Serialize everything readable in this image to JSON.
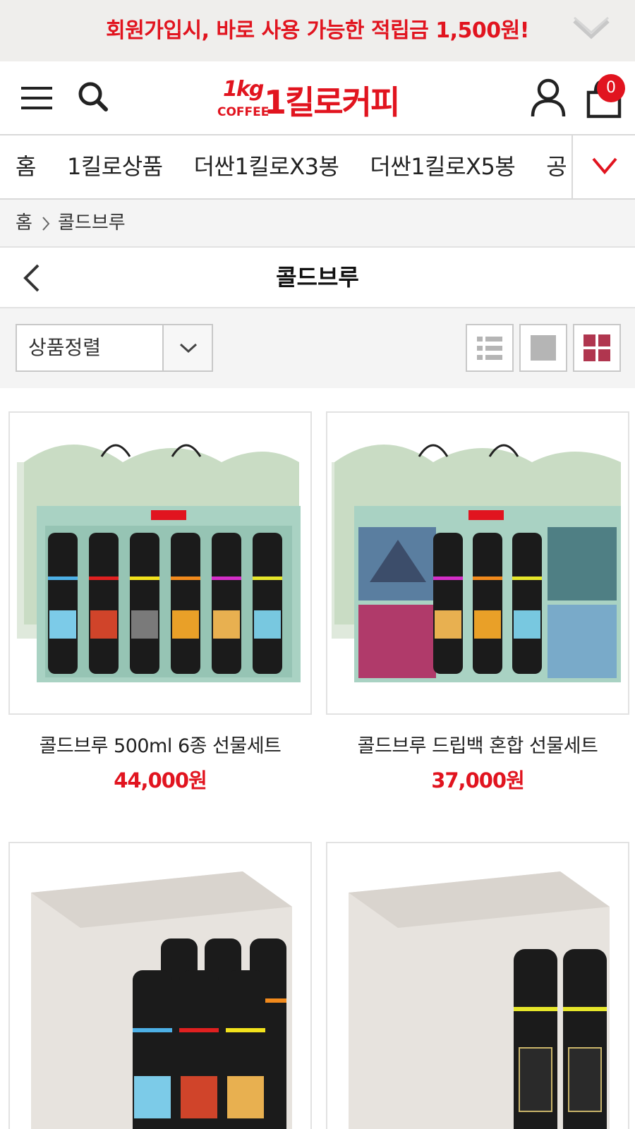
{
  "promo": {
    "text": "회원가입시, 바로 사용 가능한 적립금 1,500원!"
  },
  "header": {
    "logo_mark": "1kg",
    "logo_sub": "COFFEE",
    "logo_text": "1킬로커피",
    "cart_count": "0"
  },
  "category_nav": {
    "items": [
      "홈",
      "1킬로상품",
      "더싼1킬로X3봉",
      "더싼1킬로X5봉",
      "공"
    ]
  },
  "breadcrumb": {
    "home": "홈",
    "current": "콜드브루"
  },
  "page": {
    "title": "콜드브루"
  },
  "toolbar": {
    "sort_label": "상품정렬"
  },
  "products": [
    {
      "name": "콜드브루 500ml 6종 선물세트",
      "price": "44,000원"
    },
    {
      "name": "콜드브루 드립백 혼합 선물세트",
      "price": "37,000원"
    },
    {
      "name": "",
      "price": ""
    },
    {
      "name": "",
      "price": ""
    }
  ],
  "colors": {
    "accent": "#e1141f",
    "toolbar_bg": "#f4f4f4",
    "promo_bg": "#efeeec"
  },
  "icons": [
    "chevron-down-icon",
    "menu-icon",
    "search-icon",
    "user-icon",
    "cart-icon",
    "chevron-right-icon",
    "back-icon",
    "list-view-icon",
    "single-view-icon",
    "grid-view-icon"
  ]
}
